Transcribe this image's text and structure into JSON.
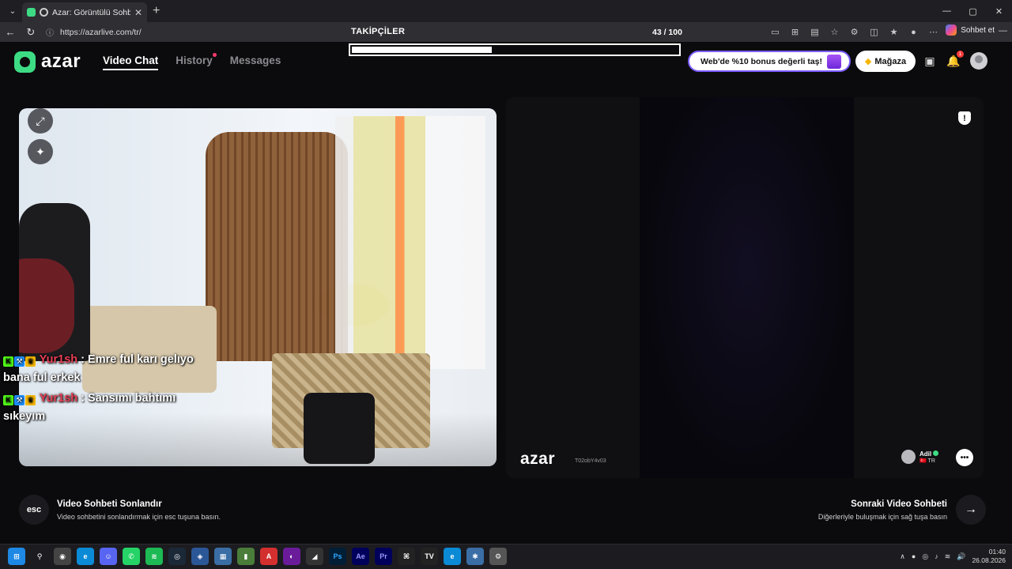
{
  "browser": {
    "tab_title": "Azar: Görüntülü Sohbet & Yen",
    "url": "https://azarlive.com/tr/",
    "copilot_label": "Sohbet et",
    "window_controls": [
      "—",
      "▢",
      "✕"
    ]
  },
  "overlay": {
    "title": "TAKİPÇİLER",
    "count": "43 / 100",
    "progress": 0.43
  },
  "header": {
    "brand": "azar",
    "nav": {
      "video_chat": "Video Chat",
      "history": "History",
      "messages": "Messages"
    },
    "promo_text": "Web'de %10 bonus değerli taş!",
    "shop_label": "Mağaza",
    "notification_count": "1"
  },
  "chat": {
    "messages": [
      {
        "user": "Yur1sh",
        "text": ": Emre ful karı gelıyo bana ful erkek"
      },
      {
        "user": "Yur1sh",
        "text": ": Sansımı bahtımı sıkeyım"
      }
    ]
  },
  "remote": {
    "watermark": "azar",
    "watermark_id": "T02obY4v03",
    "peer_name": "Adil",
    "peer_country": "TR"
  },
  "footer": {
    "esc_key": "esc",
    "end_title": "Video Sohbeti Sonlandır",
    "end_sub": "Video sohbetini sonlandırmak için esc tuşuna basın.",
    "next_title": "Sonraki Video Sohbeti",
    "next_sub": "Diğerleriyle buluşmak için sağ tuşa basın"
  },
  "taskbar": {
    "time": "01:40",
    "date": "26.08.2026"
  },
  "colors": {
    "brand_green": "#3ddc84",
    "chat_username": "#e83e55",
    "promo_border": "#7c5cff"
  }
}
